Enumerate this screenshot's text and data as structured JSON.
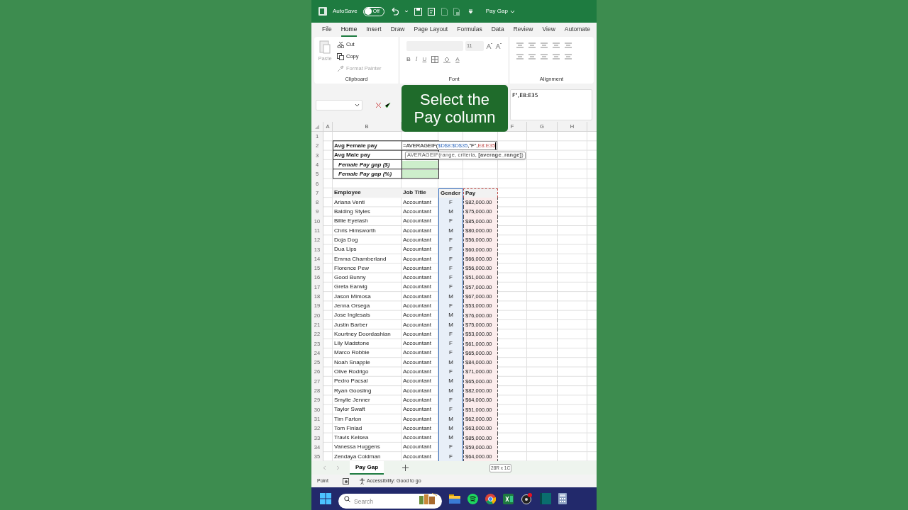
{
  "title_bar": {
    "autosave_label": "AutoSave",
    "autosave_toggle": {
      "label": "Off",
      "on": false
    },
    "document_title": "Pay Gap"
  },
  "ribbon_tabs": [
    {
      "label": "File",
      "selected": false
    },
    {
      "label": "Home",
      "selected": true
    },
    {
      "label": "Insert",
      "selected": false
    },
    {
      "label": "Draw",
      "selected": false
    },
    {
      "label": "Page Layout",
      "selected": false
    },
    {
      "label": "Formulas",
      "selected": false
    },
    {
      "label": "Data",
      "selected": false
    },
    {
      "label": "Review",
      "selected": false
    },
    {
      "label": "View",
      "selected": false
    },
    {
      "label": "Automate",
      "selected": false
    }
  ],
  "ribbon": {
    "clipboard": {
      "paste": {
        "label": "Paste",
        "disabled": true
      },
      "items": [
        {
          "label": "Cut",
          "kind": "cut",
          "disabled": false
        },
        {
          "label": "Copy",
          "kind": "copy",
          "disabled": false
        },
        {
          "label": "Format Painter",
          "kind": "brush",
          "disabled": true
        }
      ],
      "group_label": "Clipboard"
    },
    "font": {
      "size": "11",
      "styles": [
        "B",
        "I",
        "U"
      ],
      "color_letter": "A",
      "group_label": "Font"
    },
    "alignment": {
      "group_label": "Alignment"
    }
  },
  "formula_bar": {
    "formula_visible": "F\",E8:E35"
  },
  "caption": "Select the Pay column",
  "sheet": {
    "column_headers": [
      "A",
      "B",
      "F",
      "G",
      "H"
    ],
    "row_numbers": [
      "1",
      "2",
      "3",
      "4",
      "5",
      "6",
      "7",
      "8",
      "9",
      "10",
      "11",
      "12",
      "13",
      "14",
      "15",
      "16",
      "17",
      "18",
      "19",
      "20",
      "21",
      "22",
      "23",
      "24",
      "25",
      "26",
      "27",
      "28",
      "29",
      "30",
      "31",
      "32",
      "33",
      "34",
      "35"
    ],
    "summary": [
      {
        "label": "Avg Female pay",
        "kind": "plain"
      },
      {
        "label": "Avg Male pay",
        "kind": "plain"
      },
      {
        "label": "Female Pay gap ($)",
        "kind": "gap"
      },
      {
        "label": "Female Pay gap (%)",
        "kind": "gap"
      }
    ],
    "formula_parts": [
      {
        "text": "=AVERAGEIF(",
        "kind": "text"
      },
      {
        "text": "$D$8:$D$35",
        "kind": "first_ref"
      },
      {
        "text": ",\"F\",",
        "kind": "text"
      },
      {
        "text": "E8:E35",
        "kind": "second_ref"
      }
    ],
    "tooltip": "AVERAGEIF(range, criteria, **[average_range]**)",
    "columns": [
      {
        "label": "Employee",
        "kind": "text"
      },
      {
        "label": "Job Title",
        "kind": "text"
      },
      {
        "label": "Gender",
        "kind": "first_ref"
      },
      {
        "label": "Pay",
        "kind": "second_ref"
      }
    ],
    "employees": [
      {
        "name": "Ariana Venti",
        "title": "Accountant",
        "gender": "F",
        "pay": "$82,000.00"
      },
      {
        "name": "Balding Styles",
        "title": "Accountant",
        "gender": "M",
        "pay": "$75,000.00"
      },
      {
        "name": "Billie Eyelash",
        "title": "Accountant",
        "gender": "F",
        "pay": "$85,000.00"
      },
      {
        "name": "Chris Himsworth",
        "title": "Accountant",
        "gender": "M",
        "pay": "$80,000.00"
      },
      {
        "name": "Doja Dog",
        "title": "Accountant",
        "gender": "F",
        "pay": "$56,000.00"
      },
      {
        "name": "Dua Lips",
        "title": "Accountant",
        "gender": "F",
        "pay": "$60,000.00"
      },
      {
        "name": "Emma Chamberland",
        "title": "Accountant",
        "gender": "F",
        "pay": "$66,000.00"
      },
      {
        "name": "Florence Pew",
        "title": "Accountant",
        "gender": "F",
        "pay": "$56,000.00"
      },
      {
        "name": "Good Bunny",
        "title": "Accountant",
        "gender": "F",
        "pay": "$51,000.00"
      },
      {
        "name": "Greta Earwig",
        "title": "Accountant",
        "gender": "F",
        "pay": "$57,000.00"
      },
      {
        "name": "Jason Mimosa",
        "title": "Accountant",
        "gender": "M",
        "pay": "$67,000.00"
      },
      {
        "name": "Jenna Orsega",
        "title": "Accountant",
        "gender": "F",
        "pay": "$53,000.00"
      },
      {
        "name": "Jose Inglesais",
        "title": "Accountant",
        "gender": "M",
        "pay": "$76,000.00"
      },
      {
        "name": "Justin Barber",
        "title": "Accountant",
        "gender": "M",
        "pay": "$75,000.00"
      },
      {
        "name": "Kourtney Doordashian",
        "title": "Accountant",
        "gender": "F",
        "pay": "$53,000.00"
      },
      {
        "name": "Lily Madstone",
        "title": "Accountant",
        "gender": "F",
        "pay": "$61,000.00"
      },
      {
        "name": "Marco Robbie",
        "title": "Accountant",
        "gender": "F",
        "pay": "$65,000.00"
      },
      {
        "name": "Noah Snapple",
        "title": "Accountant",
        "gender": "M",
        "pay": "$84,000.00"
      },
      {
        "name": "Olive Rodrigo",
        "title": "Accountant",
        "gender": "F",
        "pay": "$71,000.00"
      },
      {
        "name": "Pedro Pacsal",
        "title": "Accountant",
        "gender": "M",
        "pay": "$65,000.00"
      },
      {
        "name": "Ryan Goosling",
        "title": "Accountant",
        "gender": "M",
        "pay": "$82,000.00"
      },
      {
        "name": "Smylie Jenner",
        "title": "Accountant",
        "gender": "F",
        "pay": "$64,000.00"
      },
      {
        "name": "Taylor Swaft",
        "title": "Accountant",
        "gender": "F",
        "pay": "$51,000.00"
      },
      {
        "name": "Tim Farton",
        "title": "Accountant",
        "gender": "M",
        "pay": "$62,000.00"
      },
      {
        "name": "Tom Finlad",
        "title": "Accountant",
        "gender": "M",
        "pay": "$63,000.00"
      },
      {
        "name": "Travis Kelsea",
        "title": "Accountant",
        "gender": "M",
        "pay": "$85,000.00"
      },
      {
        "name": "Vanessa Huggens",
        "title": "Accountant",
        "gender": "F",
        "pay": "$59,000.00"
      },
      {
        "name": "Zendaya Coldman",
        "title": "Accountant",
        "gender": "F",
        "pay": "$64,000.00"
      }
    ]
  },
  "sheet_tabs": [
    {
      "label": "Pay Gap",
      "selected": true
    }
  ],
  "selection_tip": "28R x 1C",
  "status_bar": {
    "mode": "Point",
    "accessibility": "Accessibility: Good to go"
  },
  "taskbar": {
    "search_placeholder": "Search"
  }
}
